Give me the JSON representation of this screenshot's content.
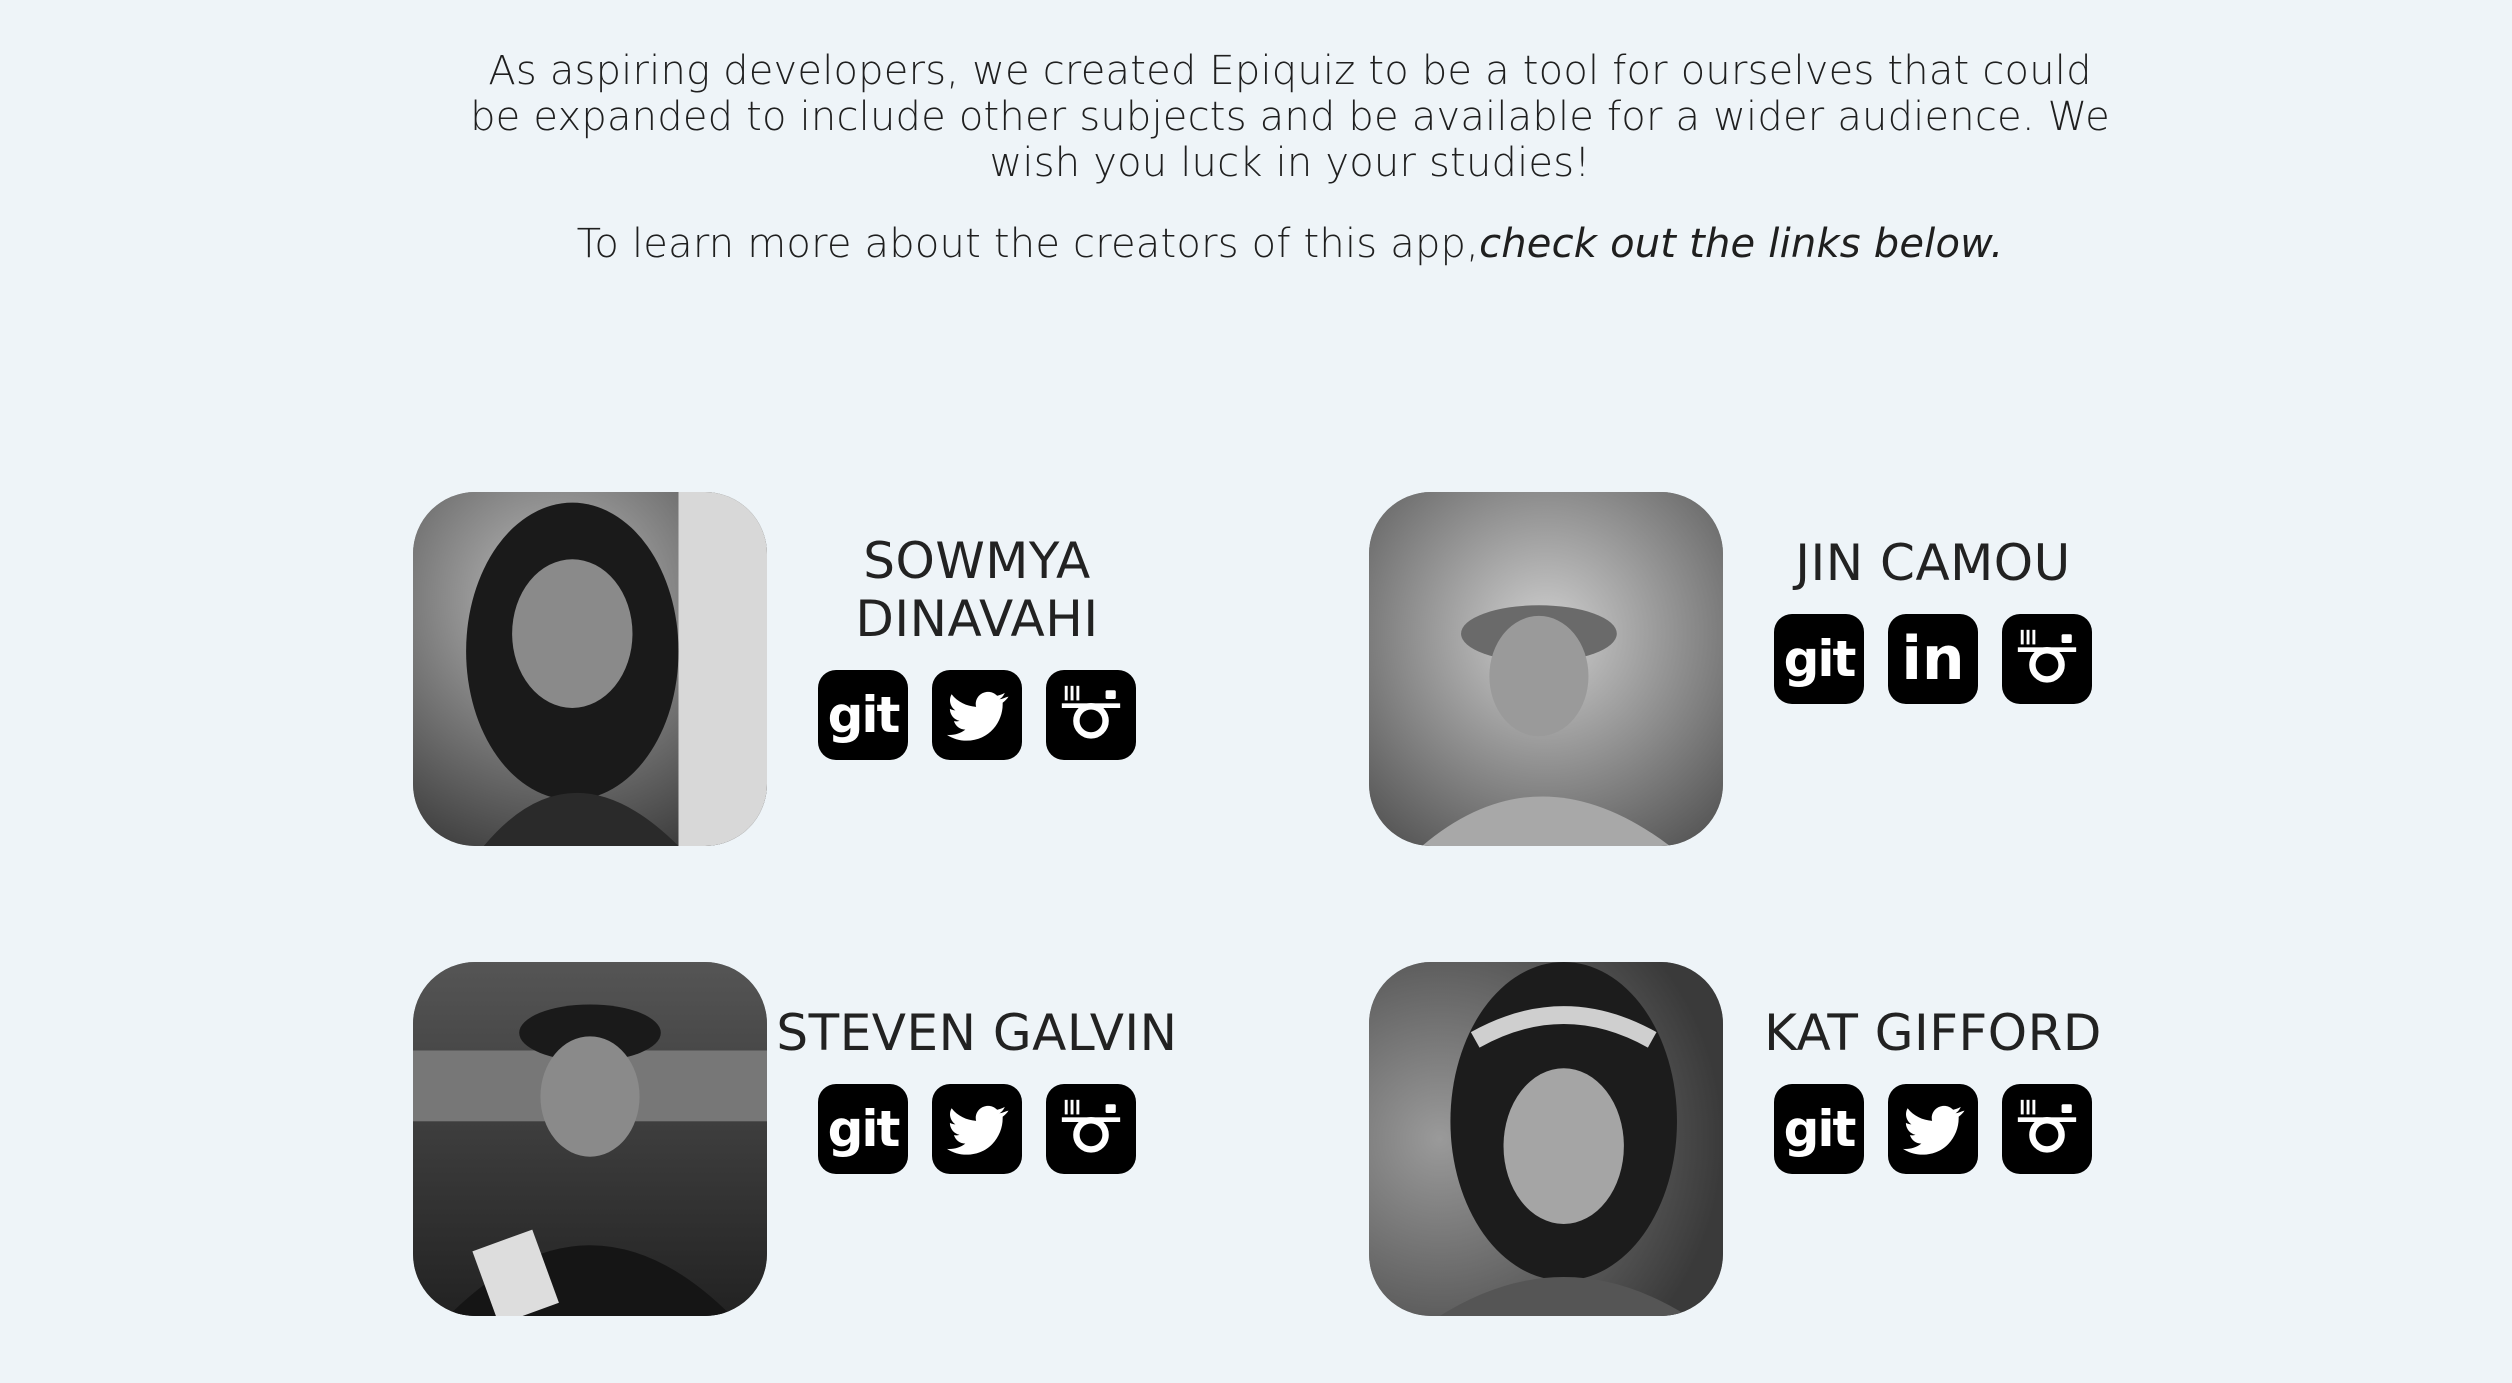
{
  "intro": {
    "paragraph": "As aspiring developers, we created Epiquiz to be a tool for ourselves that could be expanded to include other subjects and be available for a wider audience. We wish you luck in your studies!",
    "links_prefix": "To learn more about the creators of this app,",
    "links_emphasis": "check out the links below."
  },
  "creators": [
    {
      "name_line1": "SOWMYA",
      "name_line2": "DINAVAHI",
      "links": [
        "git",
        "twitter",
        "instagram"
      ]
    },
    {
      "name_line1": "JIN CAMOU",
      "name_line2": "",
      "links": [
        "git",
        "linkedin",
        "instagram"
      ]
    },
    {
      "name_line1": "STEVEN GALVIN",
      "name_line2": "",
      "links": [
        "git",
        "twitter",
        "instagram"
      ]
    },
    {
      "name_line1": "KAT GIFFORD",
      "name_line2": "",
      "links": [
        "git",
        "twitter",
        "instagram"
      ]
    }
  ],
  "icons": {
    "git": "git",
    "linkedin": "in"
  },
  "colors": {
    "background": "#eef4f8",
    "icon_background": "#000000",
    "text": "#222222"
  }
}
